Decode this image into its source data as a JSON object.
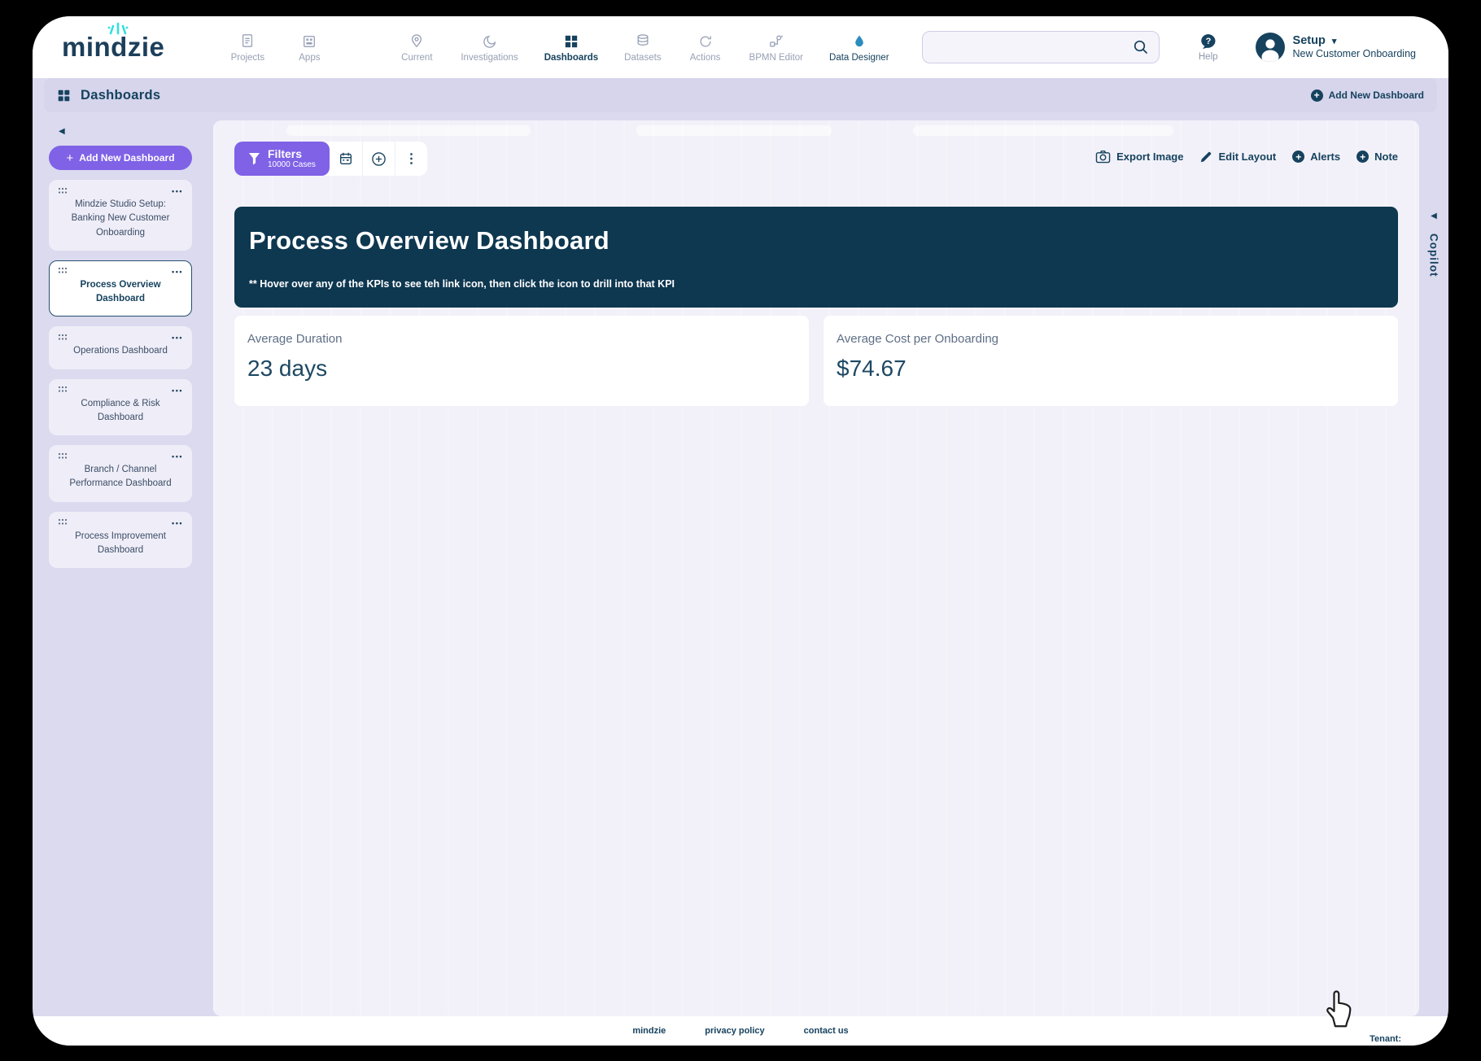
{
  "colors": {
    "accent_purple": "#7f62e6",
    "brand_navy": "#16425e",
    "title_panel_bg": "#0e3750",
    "page_lavender": "#dbdaef",
    "panel_bg": "#f2f1f9",
    "crown_cyan": "#35dede",
    "droplet_blue": "#2b8cbe"
  },
  "brand": {
    "logo_text": "mindzie"
  },
  "nav": {
    "items": [
      {
        "label": "Projects"
      },
      {
        "label": "Apps"
      },
      {
        "label": "Current"
      },
      {
        "label": "Investigations"
      },
      {
        "label": "Dashboards"
      },
      {
        "label": "Datasets"
      },
      {
        "label": "Actions"
      },
      {
        "label": "BPMN Editor"
      },
      {
        "label": "Data Designer"
      }
    ],
    "search_placeholder": "",
    "help_label": "Help",
    "user": {
      "name": "Setup",
      "workspace": "New Customer Onboarding"
    }
  },
  "page_header": {
    "title": "Dashboards",
    "add_label": "Add New Dashboard"
  },
  "sidebar": {
    "add_label": "Add New Dashboard",
    "items": [
      {
        "label": "Mindzie Studio Setup: Banking New Customer Onboarding"
      },
      {
        "label": "Process Overview Dashboard"
      },
      {
        "label": "Operations Dashboard"
      },
      {
        "label": "Compliance & Risk Dashboard"
      },
      {
        "label": "Branch / Channel Performance Dashboard"
      },
      {
        "label": "Process Improvement Dashboard"
      }
    ]
  },
  "toolbar": {
    "filters_label": "Filters",
    "filters_cases": "10000 Cases",
    "export_label": "Export Image",
    "edit_layout_label": "Edit Layout",
    "alerts_label": "Alerts",
    "note_label": "Note"
  },
  "dashboard": {
    "title": "Process Overview Dashboard",
    "note": "** Hover over any of the KPIs to see teh link icon, then click the icon to drill into that KPI",
    "kpis": [
      {
        "label": "Average Duration",
        "value": "23 days"
      },
      {
        "label": "Average Cost per Onboarding",
        "value": "$74.67"
      }
    ]
  },
  "copilot_label": "Copilot",
  "footer": {
    "links": [
      "mindzie",
      "privacy policy",
      "contact us"
    ],
    "tenant": "Tenant:"
  }
}
